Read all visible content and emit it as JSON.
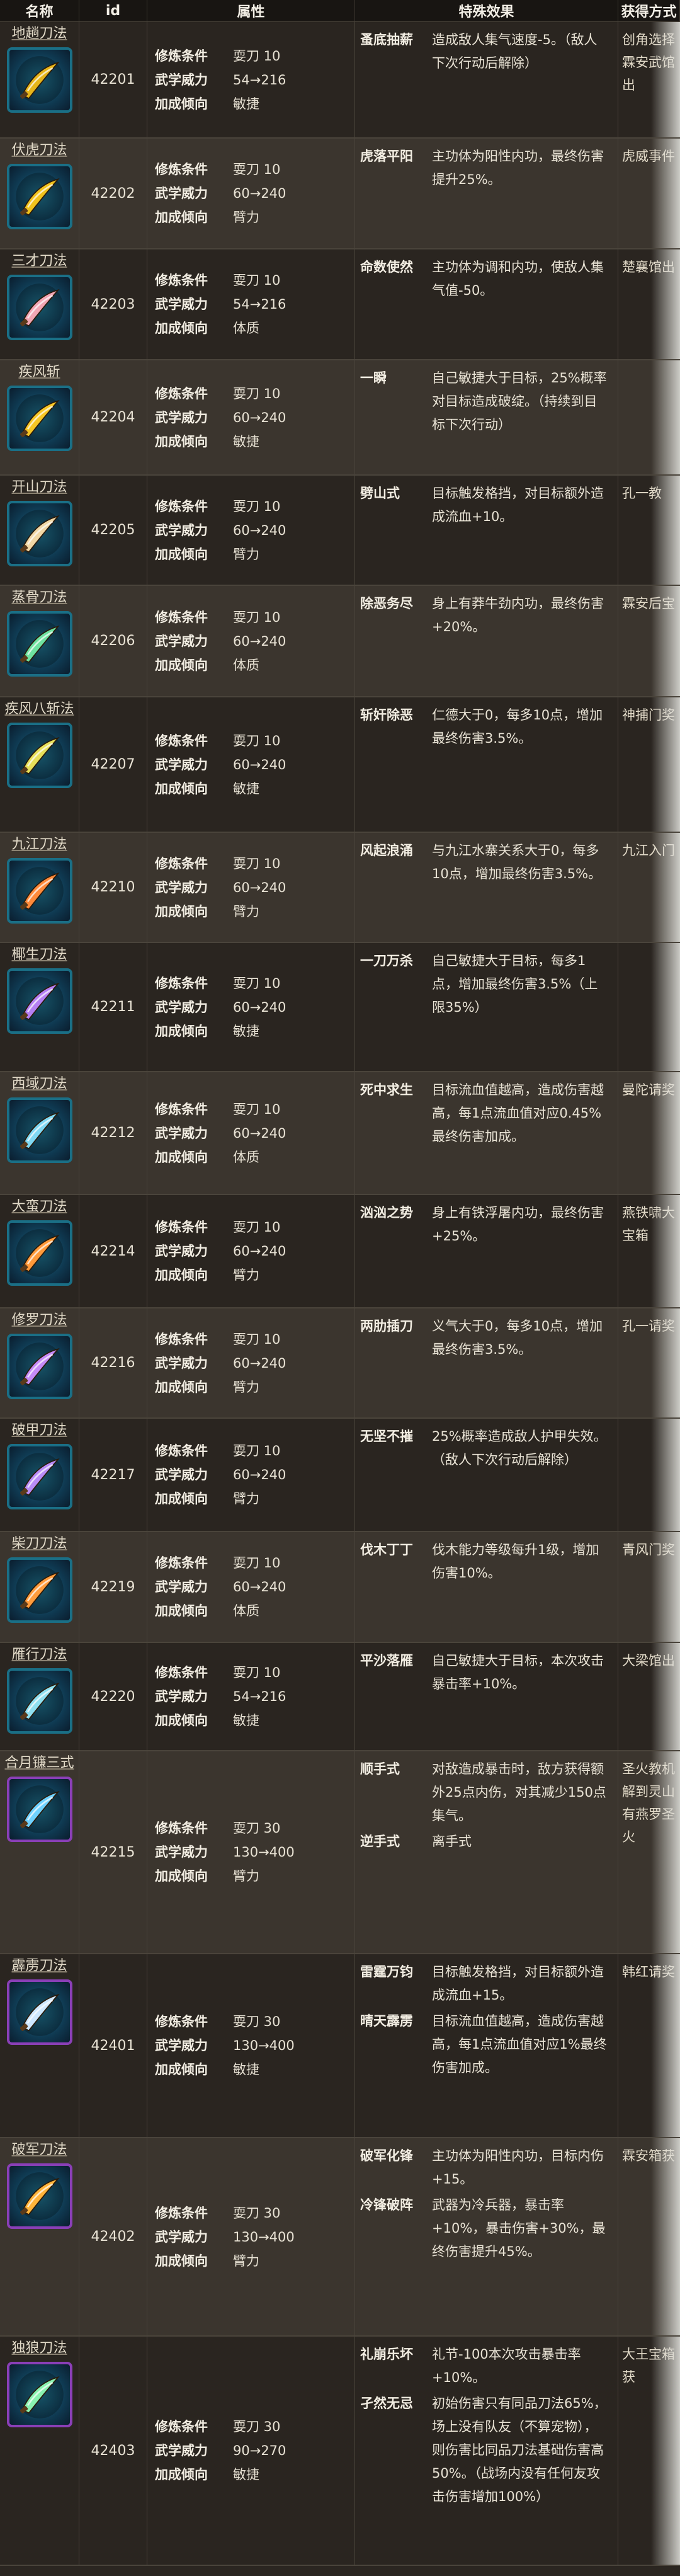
{
  "header": {
    "name": "名称",
    "id": "id",
    "attr": "属性",
    "effect": "特殊效果",
    "source": "获得方式"
  },
  "attr_labels": {
    "req": "修炼条件",
    "power": "武学威力",
    "bias": "加成倾向"
  },
  "rows": [
    {
      "name": "地趟刀法",
      "id": "42201",
      "req": "耍刀 10",
      "power": "54→216",
      "bias": "敏捷",
      "effects": [
        {
          "title": "蚤底抽薪",
          "desc": "造成敌人集气速度-5。（敌人下次行动后解除）"
        }
      ],
      "source": "创角选择霖安武馆出",
      "color": "#e6b51a",
      "purple": false
    },
    {
      "name": "伏虎刀法",
      "id": "42202",
      "req": "耍刀 10",
      "power": "60→240",
      "bias": "臂力",
      "effects": [
        {
          "title": "虎落平阳",
          "desc": "主功体为阳性内功，最终伤害提升25%。"
        }
      ],
      "source": "虎威事件",
      "color": "#f0c21c",
      "purple": false
    },
    {
      "name": "三才刀法",
      "id": "42203",
      "req": "耍刀 10",
      "power": "54→216",
      "bias": "体质",
      "effects": [
        {
          "title": "命数使然",
          "desc": "主功体为调和内功，使敌人集气值-50。"
        }
      ],
      "source": "楚襄馆出",
      "color": "#f2a6b4",
      "purple": false
    },
    {
      "name": "疾风斩",
      "id": "42204",
      "req": "耍刀 10",
      "power": "60→240",
      "bias": "敏捷",
      "effects": [
        {
          "title": "一瞬",
          "desc": "自己敏捷大于目标，25%概率对目标造成破绽。（持续到目标下次行动）"
        }
      ],
      "source": "",
      "color": "#f6c625",
      "purple": false
    },
    {
      "name": "开山刀法",
      "id": "42205",
      "req": "耍刀 10",
      "power": "60→240",
      "bias": "臂力",
      "effects": [
        {
          "title": "劈山式",
          "desc": "目标触发格挡，对目标额外造成流血+10。"
        }
      ],
      "source": "孔一教",
      "color": "#f1d8a6",
      "purple": false
    },
    {
      "name": "蒸骨刀法",
      "id": "42206",
      "req": "耍刀 10",
      "power": "60→240",
      "bias": "体质",
      "effects": [
        {
          "title": "除恶务尽",
          "desc": "身上有莽牛劲内功，最终伤害+20%。"
        }
      ],
      "source": "霖安后宝",
      "color": "#6fe2a0",
      "purple": false
    },
    {
      "name": "疾风八斩法",
      "id": "42207",
      "req": "耍刀 10",
      "power": "60→240",
      "bias": "敏捷",
      "effects": [
        {
          "title": "斩奸除恶",
          "desc": "仁德大于0，每多10点，增加最终伤害3.5%。"
        }
      ],
      "source": "神捕门奖",
      "color": "#e8e05a",
      "purple": false
    },
    {
      "name": "九江刀法",
      "id": "42210",
      "req": "耍刀 10",
      "power": "60→240",
      "bias": "臂力",
      "effects": [
        {
          "title": "风起浪涌",
          "desc": "与九江水寨关系大于0，每多10点，增加最终伤害3.5%。"
        }
      ],
      "source": "九江入门",
      "color": "#ff8a3a",
      "purple": false
    },
    {
      "name": "椰生刀法",
      "id": "42211",
      "req": "耍刀 10",
      "power": "60→240",
      "bias": "敏捷",
      "effects": [
        {
          "title": "一刀万杀",
          "desc": "自己敏捷大于目标，每多1点，增加最终伤害3.5%（上限35%）"
        }
      ],
      "source": "",
      "color": "#b57ff2",
      "purple": false
    },
    {
      "name": "西域刀法",
      "id": "42212",
      "req": "耍刀 10",
      "power": "60→240",
      "bias": "体质",
      "effects": [
        {
          "title": "死中求生",
          "desc": "目标流血值越高，造成伤害越高，每1点流血值对应0.45%最终伤害加成。"
        }
      ],
      "source": "曼陀请奖",
      "color": "#7fd8f2",
      "purple": false
    },
    {
      "name": "大蛮刀法",
      "id": "42214",
      "req": "耍刀 10",
      "power": "60→240",
      "bias": "臂力",
      "effects": [
        {
          "title": "汹汹之势",
          "desc": "身上有铁浮屠内功，最终伤害+25%。"
        }
      ],
      "source": "燕铁啸大宝箱",
      "color": "#ff9a3a",
      "purple": false
    },
    {
      "name": "修罗刀法",
      "id": "42216",
      "req": "耍刀 10",
      "power": "60→240",
      "bias": "臂力",
      "effects": [
        {
          "title": "两肋插刀",
          "desc": "义气大于0，每多10点，增加最终伤害3.5%。"
        }
      ],
      "source": "孔一请奖",
      "color": "#c58af7",
      "purple": false
    },
    {
      "name": "破甲刀法",
      "id": "42217",
      "req": "耍刀 10",
      "power": "60→240",
      "bias": "臂力",
      "effects": [
        {
          "title": "无坚不摧",
          "desc": "25%概率造成敌人护甲失效。（敌人下次行动后解除）"
        }
      ],
      "source": "",
      "color": "#b98cf7",
      "purple": false
    },
    {
      "name": "柴刀刀法",
      "id": "42219",
      "req": "耍刀 10",
      "power": "60→240",
      "bias": "体质",
      "effects": [
        {
          "title": "伐木丁丁",
          "desc": "伐木能力等级每升1级，增加伤害10%。"
        }
      ],
      "source": "青风门奖",
      "color": "#ff9c3c",
      "purple": false
    },
    {
      "name": "雁行刀法",
      "id": "42220",
      "req": "耍刀 10",
      "power": "54→216",
      "bias": "敏捷",
      "effects": [
        {
          "title": "平沙落雁",
          "desc": "自己敏捷大于目标，本次攻击暴击率+10%。"
        }
      ],
      "source": "大梁馆出",
      "color": "#8fe0f0",
      "purple": false
    },
    {
      "name": "合月镰三式",
      "id": "42215",
      "req": "耍刀 30",
      "power": "130→400",
      "bias": "臂力",
      "effects": [
        {
          "title": "顺手式",
          "desc": "对敌造成暴击时，敌方获得额外25点内伤，对其减少150点集气。"
        },
        {
          "title": "逆手式",
          "desc": "离手式"
        }
      ],
      "source": "圣火教机解到灵山有燕罗圣火",
      "color": "#6fd2ff",
      "purple": true
    },
    {
      "name": "霹雳刀法",
      "id": "42401",
      "req": "耍刀 30",
      "power": "130→400",
      "bias": "敏捷",
      "effects": [
        {
          "title": "雷霆万钧",
          "desc": "目标触发格挡，对目标额外造成流血+15。"
        },
        {
          "title": "晴天霹雳",
          "desc": "目标流血值越高，造成伤害越高，每1点流血值对应1%最终伤害加成。"
        }
      ],
      "source": "韩红请奖",
      "color": "#cfe8ff",
      "purple": true
    },
    {
      "name": "破军刀法",
      "id": "42402",
      "req": "耍刀 30",
      "power": "130→400",
      "bias": "臂力",
      "effects": [
        {
          "title": "破军化锋",
          "desc": "主功体为阳性内功，目标内伤+15。"
        },
        {
          "title": "冷锋破阵",
          "desc": "武器为冷兵器，暴击率+10%，暴击伤害+30%，最终伤害提升45%。"
        }
      ],
      "source": "霖安箱获",
      "color": "#ffb43a",
      "purple": true
    },
    {
      "name": "独狼刀法",
      "id": "42403",
      "req": "耍刀 30",
      "power": "90→270",
      "bias": "敏捷",
      "effects": [
        {
          "title": "礼崩乐坏",
          "desc": "礼节-100本次攻击暴击率+10%。"
        },
        {
          "title": "孑然无忌",
          "desc": "初始伤害只有同品刀法65%，场上没有队友（不算宠物），则伤害比同品刀法基础伤害高50%。（战场内没有任何友攻击伤害增加100%）"
        }
      ],
      "source": "大王宝箱获",
      "color": "#8af2b0",
      "purple": true
    }
  ]
}
